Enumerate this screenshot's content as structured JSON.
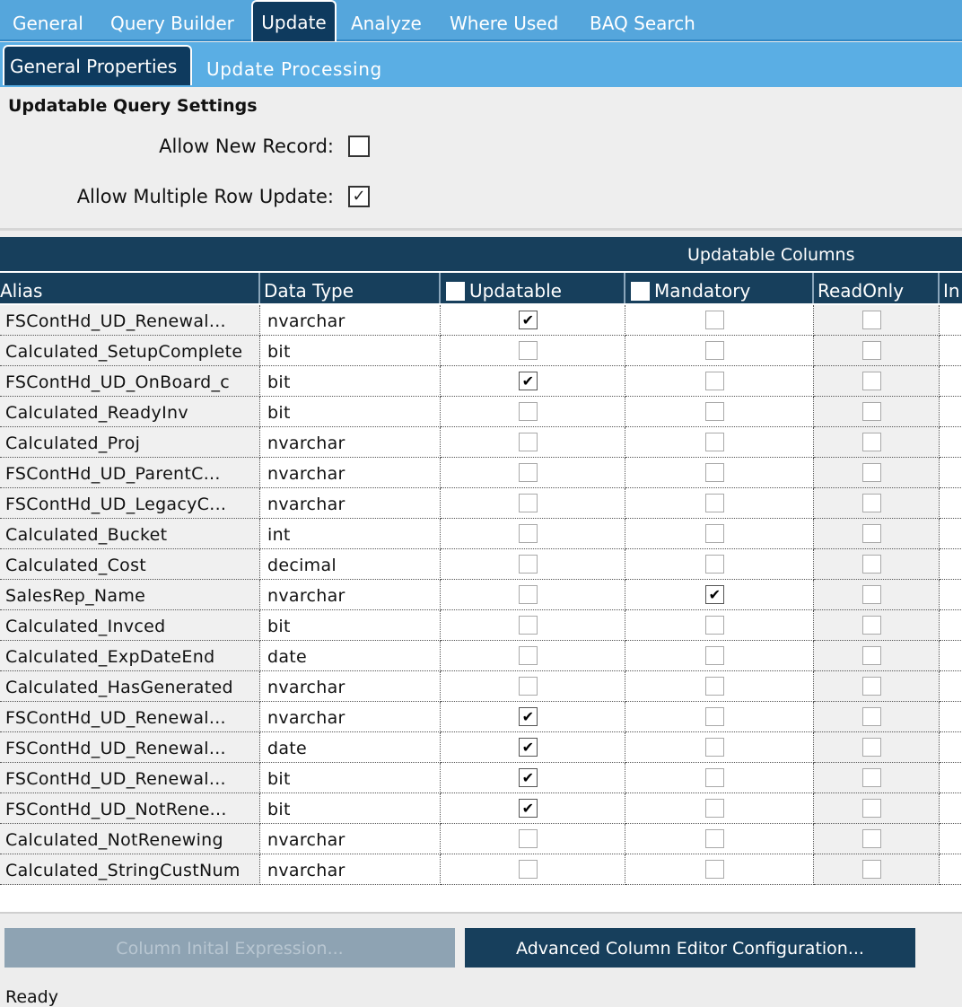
{
  "tabs_top": [
    "General",
    "Query Builder",
    "Update",
    "Analyze",
    "Where Used",
    "BAQ Search"
  ],
  "tabs_sub": [
    "General Properties",
    "Update  Processing"
  ],
  "settings": {
    "title": "Updatable Query Settings",
    "allow_new_record_label": "Allow New Record:",
    "allow_new_record": false,
    "allow_multi_row_label": "Allow Multiple Row Update:",
    "allow_multi_row": true
  },
  "grid": {
    "band_title": "Updatable Columns",
    "headers": [
      "Alias",
      "Data Type",
      "Updatable",
      "Mandatory",
      "ReadOnly",
      "In"
    ],
    "rows": [
      {
        "alias": "FSContHd_UD_Renewal...",
        "type": "nvarchar",
        "updatable": true,
        "mandatory": false,
        "readonly": false
      },
      {
        "alias": "Calculated_SetupComplete",
        "type": "bit",
        "updatable": false,
        "mandatory": false,
        "readonly": false
      },
      {
        "alias": "FSContHd_UD_OnBoard_c",
        "type": "bit",
        "updatable": true,
        "mandatory": false,
        "readonly": false
      },
      {
        "alias": "Calculated_ReadyInv",
        "type": "bit",
        "updatable": false,
        "mandatory": false,
        "readonly": false
      },
      {
        "alias": "Calculated_Proj",
        "type": "nvarchar",
        "updatable": false,
        "mandatory": false,
        "readonly": false
      },
      {
        "alias": "FSContHd_UD_ParentC...",
        "type": "nvarchar",
        "updatable": false,
        "mandatory": false,
        "readonly": false
      },
      {
        "alias": "FSContHd_UD_LegacyC...",
        "type": "nvarchar",
        "updatable": false,
        "mandatory": false,
        "readonly": false
      },
      {
        "alias": "Calculated_Bucket",
        "type": "int",
        "updatable": false,
        "mandatory": false,
        "readonly": false
      },
      {
        "alias": "Calculated_Cost",
        "type": "decimal",
        "updatable": false,
        "mandatory": false,
        "readonly": false
      },
      {
        "alias": "SalesRep_Name",
        "type": "nvarchar",
        "updatable": false,
        "mandatory": true,
        "readonly": false
      },
      {
        "alias": "Calculated_Invced",
        "type": "bit",
        "updatable": false,
        "mandatory": false,
        "readonly": false
      },
      {
        "alias": "Calculated_ExpDateEnd",
        "type": "date",
        "updatable": false,
        "mandatory": false,
        "readonly": false
      },
      {
        "alias": "Calculated_HasGenerated",
        "type": "nvarchar",
        "updatable": false,
        "mandatory": false,
        "readonly": false
      },
      {
        "alias": "FSContHd_UD_Renewal...",
        "type": "nvarchar",
        "updatable": true,
        "mandatory": false,
        "readonly": false
      },
      {
        "alias": "FSContHd_UD_Renewal...",
        "type": "date",
        "updatable": true,
        "mandatory": false,
        "readonly": false
      },
      {
        "alias": "FSContHd_UD_Renewal...",
        "type": "bit",
        "updatable": true,
        "mandatory": false,
        "readonly": false
      },
      {
        "alias": "FSContHd_UD_NotRene...",
        "type": "bit",
        "updatable": true,
        "mandatory": false,
        "readonly": false
      },
      {
        "alias": "Calculated_NotRenewing",
        "type": "nvarchar",
        "updatable": false,
        "mandatory": false,
        "readonly": false
      },
      {
        "alias": "Calculated_StringCustNum",
        "type": "nvarchar",
        "updatable": false,
        "mandatory": false,
        "readonly": false
      }
    ]
  },
  "buttons": {
    "column_initial_expression": "Column Inital Expression...",
    "advanced_config": "Advanced Column Editor Configuration..."
  },
  "status_text": "Ready"
}
